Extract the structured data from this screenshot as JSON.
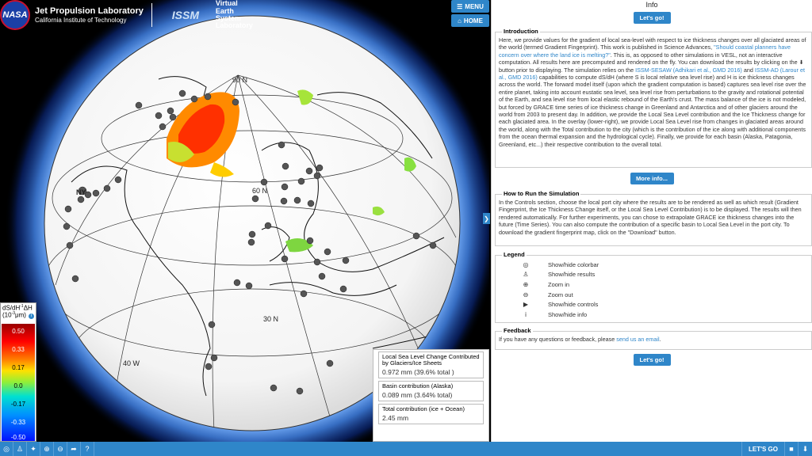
{
  "header": {
    "nasa": "NASA",
    "jpl_title": "Jet Propulsion Laboratory",
    "jpl_sub": "California Institute of Technology",
    "issm": "ISSM",
    "vesl": [
      "Virtual",
      "Earth",
      "System",
      "Laboratory"
    ]
  },
  "nav": {
    "menu_label": "MENU",
    "home_label": "HOME"
  },
  "globe": {
    "labels": [
      "90 N",
      "60 N",
      "30 N",
      "40 W"
    ],
    "ny_label": "NY"
  },
  "colorbar": {
    "title_line1": "dS/dH",
    "title_sup1": "-1",
    "title_line1b": "ΔH",
    "title_line2": "(10",
    "title_sup2": "-3",
    "title_line2b": "μm)",
    "ticks": [
      "0.50",
      "0.33",
      "0.17",
      "0.0",
      "-0.17",
      "-0.33",
      "-0.50"
    ]
  },
  "results": {
    "local": {
      "title": "Local Sea Level Change Contributed by Glaciers/Ice Sheets",
      "value": "0.972 mm (39.6% total )"
    },
    "basin": {
      "title": "Basin contribution (Alaska)",
      "value": "0.089 mm (3.64% total)"
    },
    "total": {
      "title": "Total contribution (ice + Ocean)",
      "value": "2.45 mm"
    }
  },
  "info": {
    "title": "Info",
    "lets_go": "Let's go!",
    "more_info": "More info...",
    "intro": {
      "title": "Introduction",
      "p1": "Here, we provide values for the gradient of local sea-level with respect to ice thickness changes over all glaciated areas of the world (termed Gradient Fingerprint). This work is published in Science Advances, ",
      "link1": "\"Should coastal planners have concern over where the land ice is melting?\"",
      "p2": ". This is, as opposed to other simulations in VESL, not an interactive computation. All results here are precomputed and rendered on the fly. You can download the results by clicking on the ",
      "p3": " button prior to displaying. The simulation relies on the ",
      "link2": "ISSM-SESAW (Adhikari et al., GMD 2016)",
      "p4": " and ",
      "link3": "ISSM-AD (Larour et al., GMD 2016)",
      "p5": " capabilities to compute dS/dH (where S is local relative sea level rise) and H is ice thickness changes across the world. The forward model itself (upon which the gradient computation is based) captures sea level rise over the entire planet, taking into account eustatic sea level, sea level rise from perturbations to the gravity and rotational potential of the Earth, and sea level rise from local elastic rebound of the Earth's crust. The mass balance of the ice is not modeled, but forced by GRACE time series of ice thickness change in Greenland and Antarctica and of other glaciers around the world from 2003 to present day. In addition, we provide the Local Sea Level contribution and the Ice Thickness change for each glaciated area. In the overlay (lower-right), we provide Local Sea Level rise from changes in glaciated areas around the world, along with the Total contribution to the city (which is the contribution of the ice along with additional components from the ocean thermal expansion and the hydrological cycle). Finally, we provide for each basin (Alaska, Patagonia, Greenland, etc...) their respective contribution to the overall total."
    },
    "howto": {
      "title": "How to Run the Simulation",
      "text": "In the Controls section, choose the local port city where the results are to be rendered as well as which result (Gradient Fingerprint, the Ice Thickness Change itself, or the Local Sea Level Contribution) is to be displayed. The results will then rendered automatically. For further experiments, you can chose to extrapolate GRACE ice thickness changes into the future (Time Series). You can also compute the contribution of a specific basin to Local Sea Level in the port city. To download the gradient fingerprint map, click on the \"Download\" button."
    },
    "legend": {
      "title": "Legend",
      "items": [
        {
          "icon": "◎",
          "label": "Show/hide colorbar"
        },
        {
          "icon": "♙",
          "label": "Show/hide results"
        },
        {
          "icon": "⊕",
          "label": "Zoom in"
        },
        {
          "icon": "⊖",
          "label": "Zoom out"
        },
        {
          "icon": "▶",
          "label": "Show/hide controls"
        },
        {
          "icon": "i",
          "label": "Show/hide info"
        }
      ]
    },
    "feedback": {
      "title": "Feedback",
      "text": "If you have any questions or feedback, please ",
      "link": "send us an email",
      "end": "."
    }
  },
  "toolbar": {
    "icons": [
      "◎",
      "♙",
      "✦",
      "⊕",
      "⊖",
      "➦",
      "?"
    ],
    "lets_go": "LET'S GO",
    "right_icons": [
      "■",
      "⬇"
    ]
  }
}
